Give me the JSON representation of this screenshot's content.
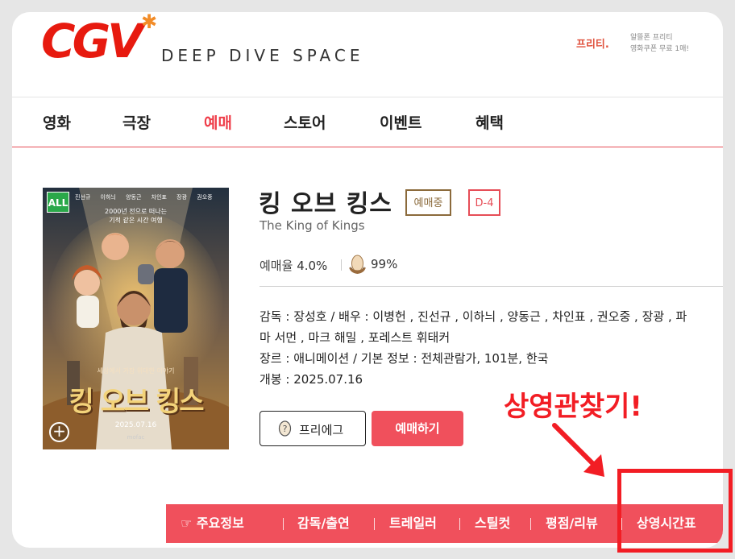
{
  "header": {
    "logo": "CGV",
    "tagline": "DEEP DIVE SPACE",
    "promo_logo": "프리티.",
    "promo_lines": [
      "알뜰폰 프리티",
      "영화쿠폰 무료 1매!"
    ]
  },
  "nav": {
    "items": [
      "영화",
      "극장",
      "예매",
      "스토어",
      "이벤트",
      "혜택"
    ],
    "active": "예매"
  },
  "poster": {
    "age_rating": "ALL",
    "cast_line": "진선규 이하늬 양동근 차인표 장광 권오중",
    "tagline_lines": [
      "2000년 전으로 떠나는",
      "기적 같은 시간 여행"
    ],
    "subtitle": "세상에서 가장 위대한 이야기",
    "title": "킹 오브 킹스",
    "date": "2025.07.16",
    "studio": "mofac"
  },
  "movie": {
    "title": "킹 오브 킹스",
    "status_badge": "예매중",
    "dday_badge": "D-4",
    "english_title": "The King of Kings",
    "booking_rate_label": "예매율",
    "booking_rate": "4.0%",
    "egg_rating": "99%",
    "info_lines": [
      "감독 : 장성호 / 배우 : 이병헌 , 진선규 , 이하늬 , 양동근 , 차인표 , 권오중 , 장광 , 파",
      "마 서먼 , 마크 해밀 , 포레스트 휘태커",
      "장르 : 애니메이션 / 기본 정보 : 전체관람가, 101분, 한국",
      "개봉 : 2025.07.16"
    ],
    "pre_egg_button": "프리에그",
    "book_button": "예매하기"
  },
  "tabs": {
    "items": [
      "주요정보",
      "감독/출연",
      "트레일러",
      "스틸컷",
      "평점/리뷰",
      "상영시간표"
    ]
  },
  "annotation": {
    "text": "상영관찾기!"
  },
  "colors": {
    "brand_red": "#e71a0f",
    "accent_pink": "#f0505c",
    "annotation_red": "#f21d24",
    "status_brown": "#8b6a3b"
  }
}
